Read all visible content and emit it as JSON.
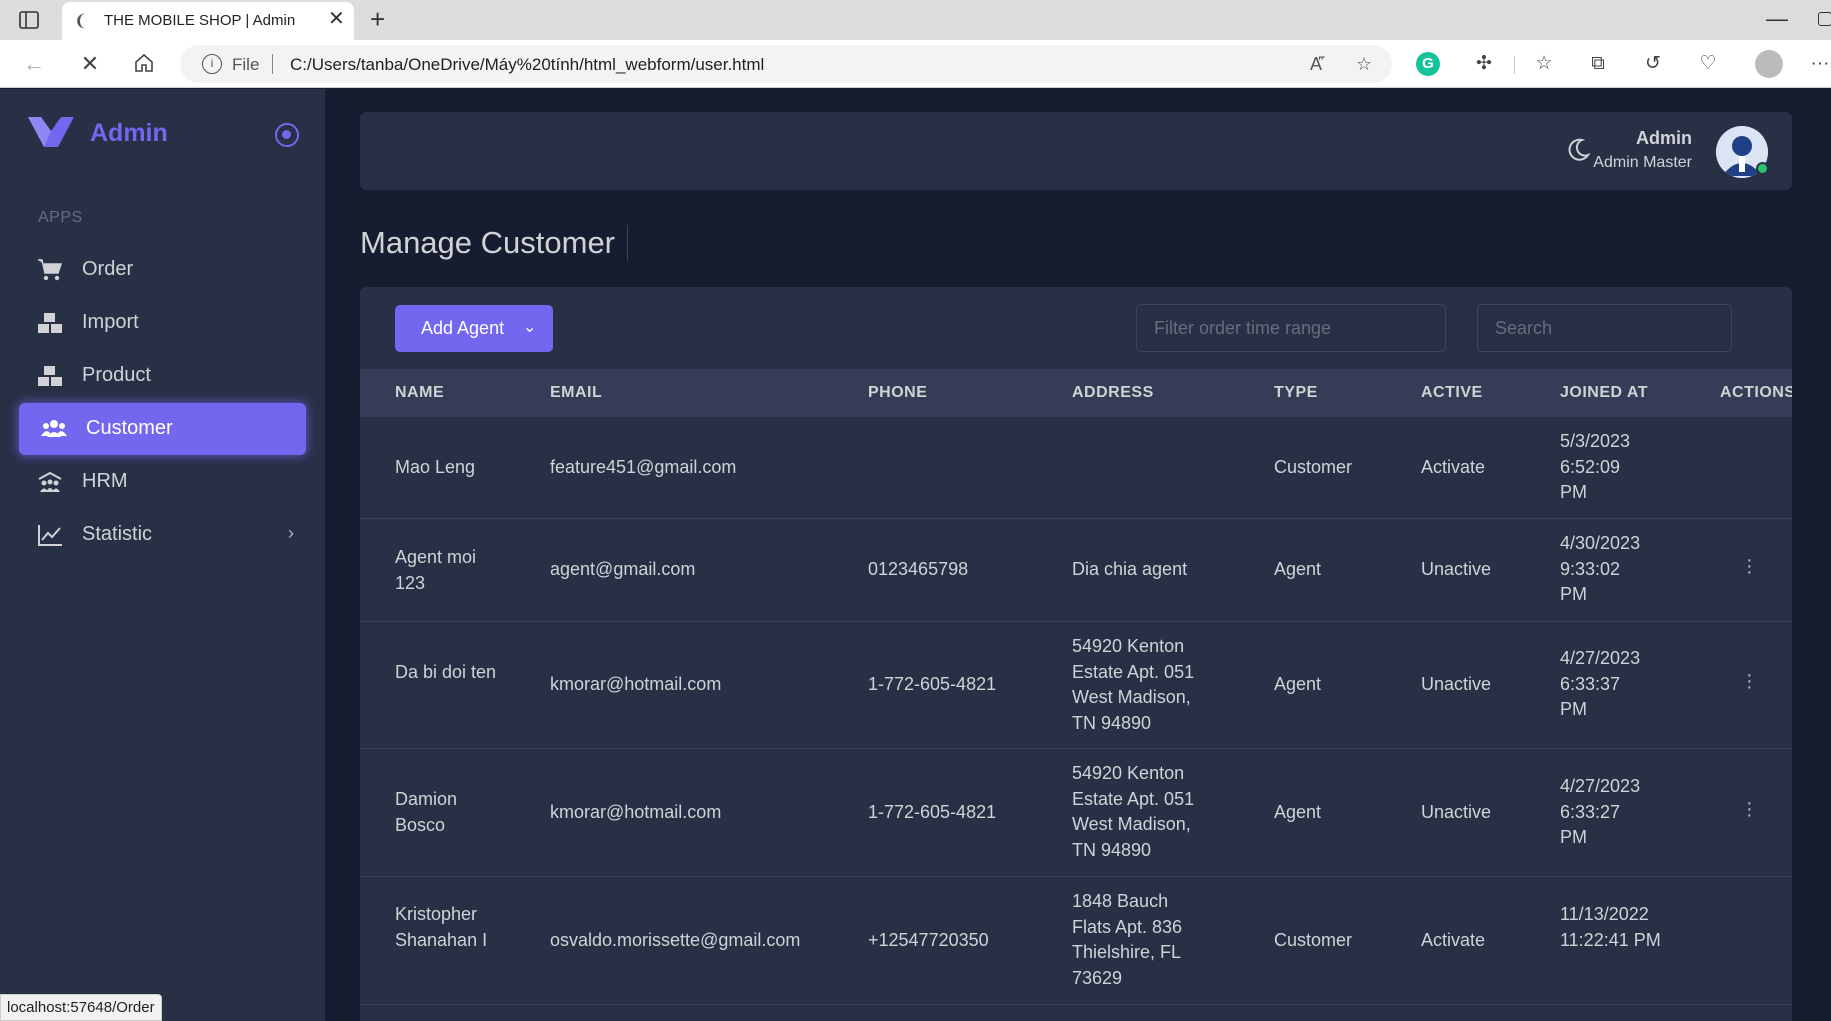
{
  "browser": {
    "tab_title": "THE MOBILE SHOP | Admin",
    "url_scheme_label": "File",
    "url": "C:/Users/tanba/OneDrive/Máy%20tính/html_webform/user.html",
    "status_url": "localhost:57648/Order"
  },
  "sidebar": {
    "brand": "Admin",
    "section_label": "APPS",
    "items": [
      {
        "label": "Order",
        "icon": "cart-icon"
      },
      {
        "label": "Import",
        "icon": "boxes-icon"
      },
      {
        "label": "Product",
        "icon": "boxes-icon"
      },
      {
        "label": "Customer",
        "icon": "users-icon",
        "active": true
      },
      {
        "label": "HRM",
        "icon": "team-icon"
      },
      {
        "label": "Statistic",
        "icon": "chart-line-icon",
        "has_submenu": true
      }
    ]
  },
  "header": {
    "user_name": "Admin",
    "user_role": "Admin Master"
  },
  "page": {
    "title": "Manage Customer",
    "add_button": "Add Agent",
    "filter_placeholder": "Filter order time range",
    "search_placeholder": "Search"
  },
  "table": {
    "columns": [
      "NAME",
      "EMAIL",
      "PHONE",
      "ADDRESS",
      "TYPE",
      "ACTIVE",
      "JOINED AT",
      "ACTIONS"
    ],
    "rows": [
      {
        "name": "Mao Leng",
        "email": "feature451@gmail.com",
        "phone": "",
        "address": "",
        "type": "Customer",
        "active": "Activate",
        "joined": "5/3/2023 6:52:09 PM",
        "has_actions": false
      },
      {
        "name": "Agent moi 123",
        "email": "agent@gmail.com",
        "phone": "0123465798",
        "address": "Dia chia agent",
        "type": "Agent",
        "active": "Unactive",
        "joined": "4/30/2023 9:33:02 PM",
        "has_actions": true
      },
      {
        "name": "Da bi doi ten",
        "email": "kmorar@hotmail.com",
        "phone": "1-772-605-4821",
        "address": "54920 Kenton Estate Apt. 051 West Madison, TN 94890",
        "type": "Agent",
        "active": "Unactive",
        "joined": "4/27/2023 6:33:37 PM",
        "has_actions": true
      },
      {
        "name": "Damion Bosco",
        "email": "kmorar@hotmail.com",
        "phone": "1-772-605-4821",
        "address": "54920 Kenton Estate Apt. 051 West Madison, TN 94890",
        "type": "Agent",
        "active": "Unactive",
        "joined": "4/27/2023 6:33:27 PM",
        "has_actions": true
      },
      {
        "name": "Kristopher Shanahan I",
        "email": "osvaldo.morissette@gmail.com",
        "phone": "+12547720350",
        "address": "1848 Bauch Flats Apt. 836 Thielshire, FL 73629",
        "type": "Customer",
        "active": "Activate",
        "joined": "11/13/2022 11:22:41 PM",
        "has_actions": false
      }
    ]
  },
  "colors": {
    "accent": "#7367f0",
    "body_bg": "#161d31",
    "card_bg": "#283046",
    "online": "#28c76f"
  }
}
